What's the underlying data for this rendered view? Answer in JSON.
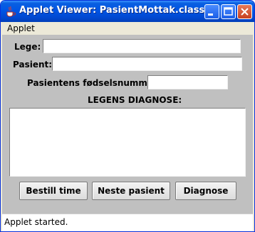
{
  "window": {
    "title": "Applet Viewer: PasientMottak.class"
  },
  "menu": {
    "items": [
      "Applet"
    ]
  },
  "form": {
    "lege_label": "Lege:",
    "lege_value": "",
    "pasient_label": "Pasient:",
    "pasient_value": "",
    "fodselsnummer_label": "Pasientens fødselsnummer:",
    "fodselsnummer_value": "",
    "diagnose_heading": "LEGENS DIAGNOSE:",
    "diagnose_text": ""
  },
  "buttons": {
    "bestill": "Bestill time",
    "neste": "Neste pasient",
    "diagnose": "Diagnose"
  },
  "status": {
    "text": "Applet started."
  },
  "icons": {
    "app": "java-coffee-icon",
    "minimize": "minimize-icon",
    "maximize": "maximize-icon",
    "close": "close-icon"
  },
  "colors": {
    "titlebar": "#0055e5",
    "content_bg": "#c0c0c0",
    "close_button": "#c8401f"
  }
}
